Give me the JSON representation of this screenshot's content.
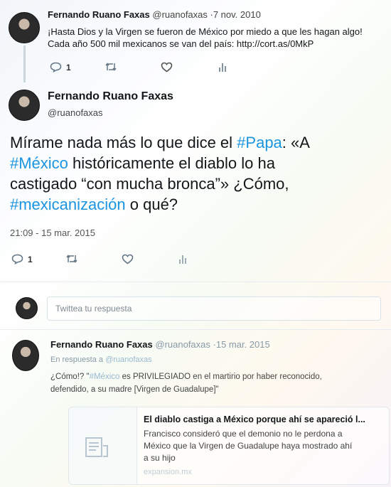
{
  "tweet1": {
    "display_name": "Fernando Ruano Faxas",
    "handle_date": "@ruanofaxas ·7 nov. 2010",
    "line1": "¡Hasta Dios y la Virgen se fueron de México por miedo a que les hagan algo!",
    "line2": "Cada año 500 mil mexicanos se van del país: http://cort.as/0MkP",
    "reply_count": "1"
  },
  "main_tweet": {
    "display_name": "Fernando Ruano Faxas",
    "handle": "@ruanofaxas",
    "text_a": "Mírame nada más lo que dice el ",
    "tag_papa": "#Papa",
    "text_b": ": «A",
    "tag_mexico": "#México",
    "text_c": " históricamente el diablo lo ha",
    "text_d": "castigado “con mucha bronca”» ¿Cómo,",
    "tag_mexicanizacion": "#mexicanización",
    "text_e": " o qué?",
    "timestamp": "21:09 - 15 mar. 2015",
    "reply_count": "1"
  },
  "reply_box": {
    "placeholder": "Twittea tu respuesta"
  },
  "reply_tweet": {
    "display_name": "Fernando Ruano Faxas",
    "handle_date": "@ruanofaxas ·15 mar. 2015",
    "in_reply_prefix": "En respuesta a ",
    "in_reply_handle": "@ruanofaxas",
    "text_a": "¿Cómo!? \"",
    "tag_mexico": "#México",
    "text_b": " es PRIVILEGIADO en el martirio por haber reconocido,",
    "text_c": "defendido, a su madre [Virgen de Guadalupe]\""
  },
  "link_card": {
    "title": "El diablo castiga a México porque ahí se apareció l...",
    "desc1": "Francisco consideró que el demonio no le perdona a",
    "desc2": "México que la Virgen de Guadalupe haya mostrado ahí",
    "desc3": "a su hijo",
    "domain": "expansion.mx",
    "icon": "document-icon"
  },
  "colors": {
    "link": "#1b95e0",
    "muted": "#8899a6"
  }
}
